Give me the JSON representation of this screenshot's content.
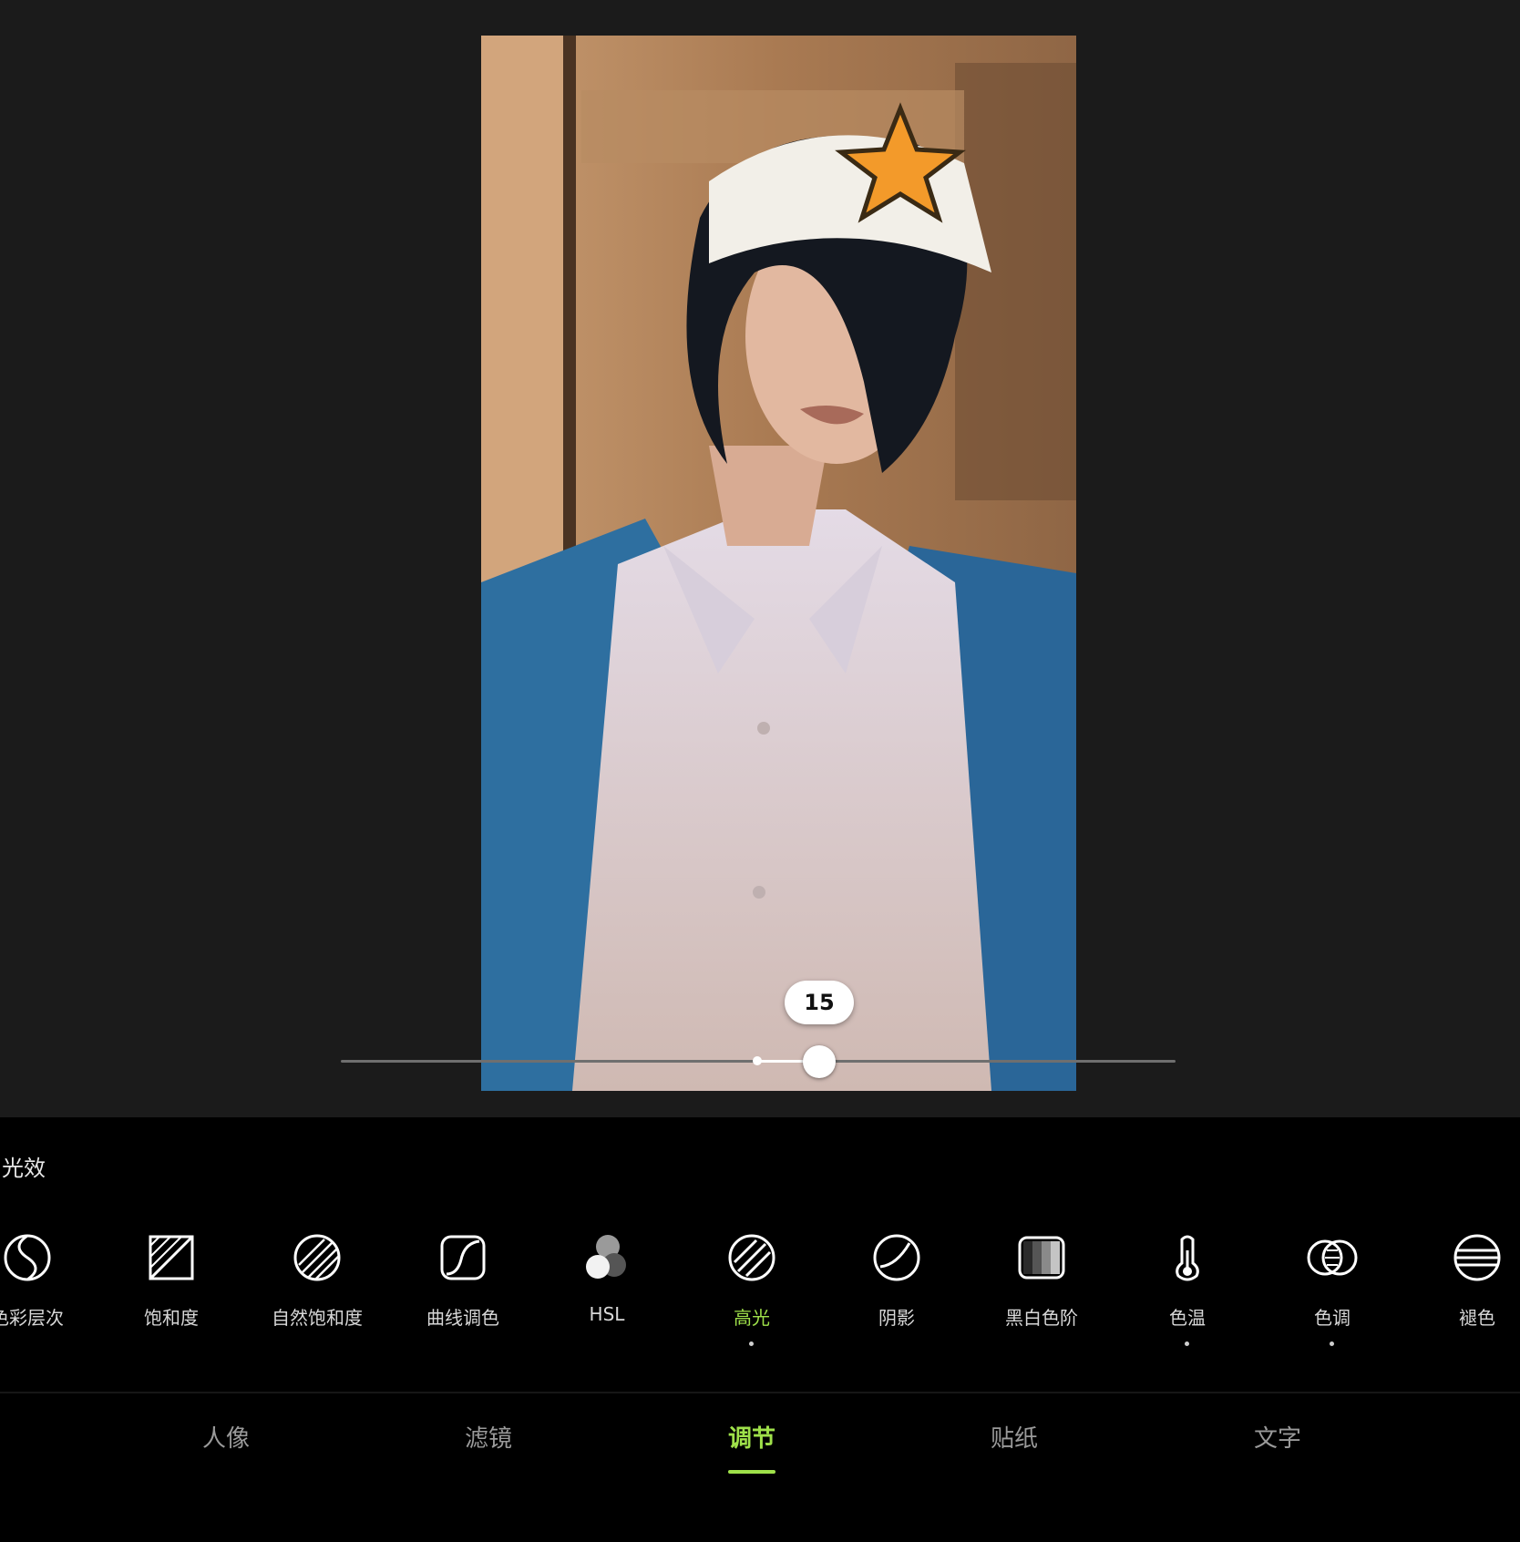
{
  "adjust": {
    "value": "15",
    "slider_fraction": 0.07
  },
  "panel": {
    "section_label": "光效"
  },
  "tools": [
    {
      "label": "色彩层次",
      "icon": "color-layers-icon"
    },
    {
      "label": "饱和度",
      "icon": "saturation-icon"
    },
    {
      "label": "自然饱和度",
      "icon": "vibrance-icon"
    },
    {
      "label": "曲线调色",
      "icon": "curves-icon"
    },
    {
      "label": "HSL",
      "icon": "hsl-icon"
    },
    {
      "label": "高光",
      "icon": "highlights-icon",
      "active": true
    },
    {
      "label": "阴影",
      "icon": "shadows-icon"
    },
    {
      "label": "黑白色阶",
      "icon": "levels-icon"
    },
    {
      "label": "色温",
      "icon": "temperature-icon"
    },
    {
      "label": "色调",
      "icon": "tint-icon"
    },
    {
      "label": "褪色",
      "icon": "fade-icon"
    }
  ],
  "nav": {
    "items": [
      "人像",
      "滤镜",
      "调节",
      "贴纸",
      "文字"
    ],
    "active": "调节"
  },
  "colors": {
    "accent": "#9fe14a",
    "panel_bg": "#000000",
    "canvas_bg": "#1b1b1b"
  }
}
